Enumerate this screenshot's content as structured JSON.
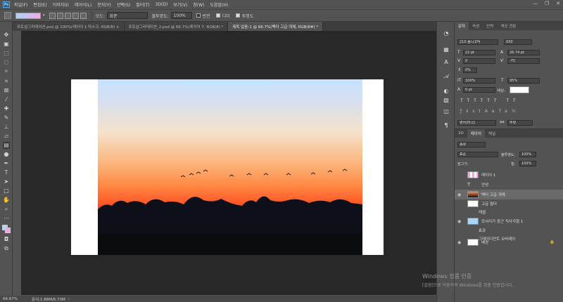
{
  "app": {
    "logo": "Ps"
  },
  "menu": [
    "파일(F)",
    "편집(E)",
    "이미지(I)",
    "레이어(L)",
    "문자(Y)",
    "선택(S)",
    "필터(T)",
    "3D(D)",
    "보기(V)",
    "창(W)",
    "도움말(H)"
  ],
  "options": {
    "mode_label": "모드:",
    "mode_value": "표준",
    "opacity_label": "불투명도:",
    "opacity_value": "100%",
    "reverse_label": "반전",
    "dither_label": "디더",
    "transparency_label": "투명도"
  },
  "tabs": [
    "포토샵그라데이션.psd @ 100%(레이어 1 마스크, RGB/8) ×",
    "포토샵그라데이션_2.psd @ 66.7%(레이어 7, RGB/8) *",
    "제목 없음-1 @ 66.7%(벡터 고급 개체, RGB/8#) *"
  ],
  "status": {
    "zoom": "66.67%",
    "doc": "문서:1.88M/6.73M"
  },
  "character": {
    "tabs": [
      "문자",
      "속성",
      "단락",
      "색상 견본"
    ],
    "font": "210 옴니고딕",
    "style": "030",
    "size": "22 pt",
    "leading": "26.74 pt",
    "kerning": "0",
    "tracking": "-75",
    "vscale_pct": "0%",
    "hscale": "100%",
    "vscale": "95%",
    "baseline": "0 pt",
    "color_label": "색상:",
    "lang": "영어(미국)",
    "aa": "뚜렷"
  },
  "layers": {
    "tabs": [
      "3D",
      "레이어",
      "채널"
    ],
    "kind": "종류",
    "blend": "표준",
    "opacity_label": "불투명도:",
    "opacity": "100%",
    "lock_label": "잠그기:",
    "fill_label": "칠:",
    "fill": "100%",
    "items": [
      {
        "name": "레이어 1",
        "type": "raster"
      },
      {
        "name": "안녕",
        "type": "text"
      },
      {
        "name": "벡터 고급 개체",
        "type": "smart"
      },
      {
        "name": "고급 필터",
        "type": "filter"
      },
      {
        "name": "레벨",
        "type": "effect"
      },
      {
        "name": "모서리가 둥근 직사각형 1",
        "type": "shape"
      },
      {
        "name": "효과",
        "type": "effect"
      },
      {
        "name": "그레이디언트 오버레이",
        "type": "effect"
      },
      {
        "name": "배경",
        "type": "bg"
      }
    ]
  },
  "watermark": {
    "line1": "Windows 정품 인증",
    "line2": "[설정]으로 이동하여 Windows를 정품 인증합니다."
  },
  "colors": {
    "accent": "#2b5c7f",
    "canvas": "#282828",
    "panel": "#535353"
  }
}
